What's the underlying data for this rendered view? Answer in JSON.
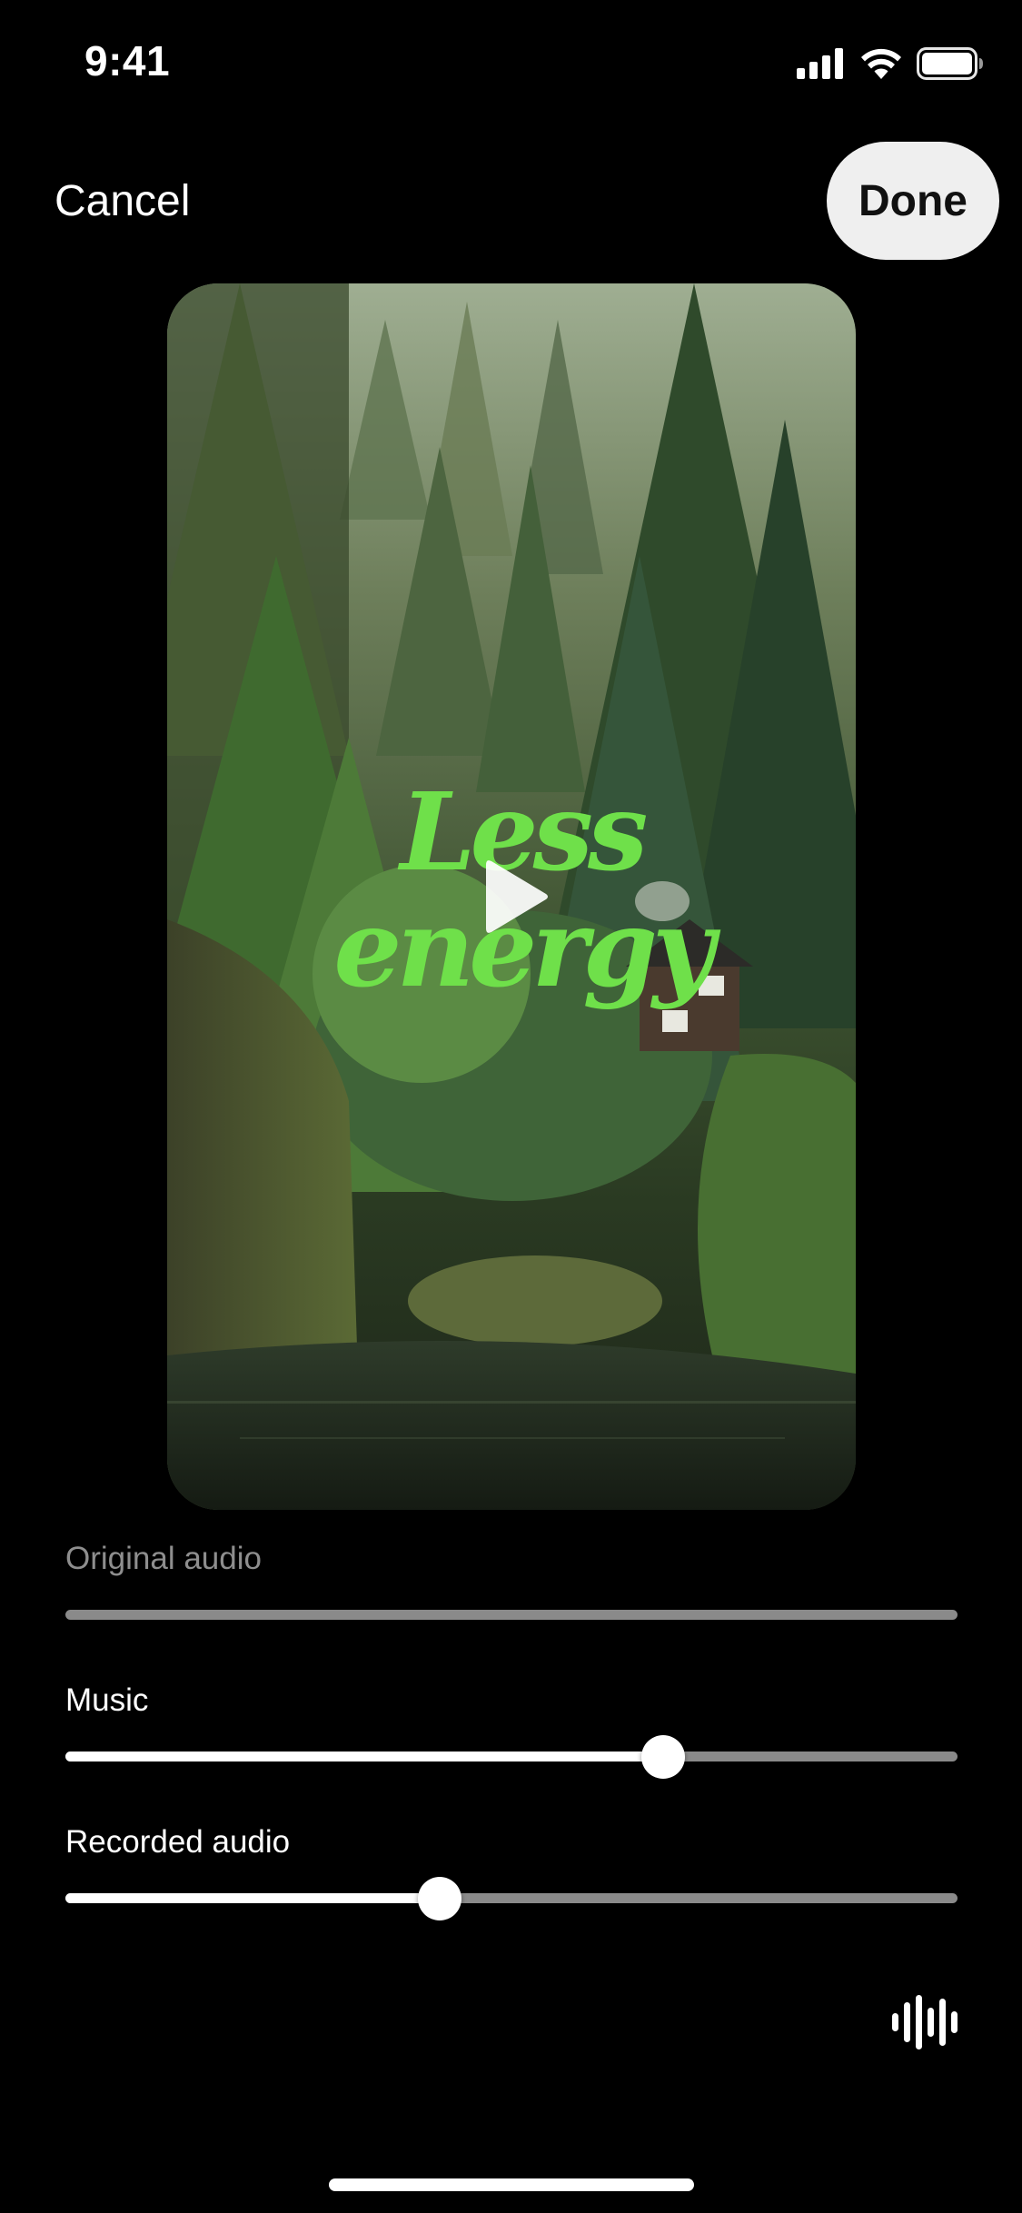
{
  "status_bar": {
    "time": "9:41",
    "icons": [
      "cellular-signal-icon",
      "wifi-icon",
      "battery-icon"
    ]
  },
  "header": {
    "cancel_label": "Cancel",
    "done_label": "Done"
  },
  "preview": {
    "overlay_line1": "Less",
    "overlay_line2": "energy",
    "overlay_color": "#6fe04a",
    "play_icon": "play-icon"
  },
  "audio": {
    "original": {
      "label": "Original audio",
      "level": 0.0,
      "enabled": false
    },
    "music": {
      "label": "Music",
      "level": 0.67
    },
    "recorded": {
      "label": "Recorded audio",
      "level": 0.42
    }
  },
  "footer": {
    "waveform_icon": "waveform-icon"
  }
}
